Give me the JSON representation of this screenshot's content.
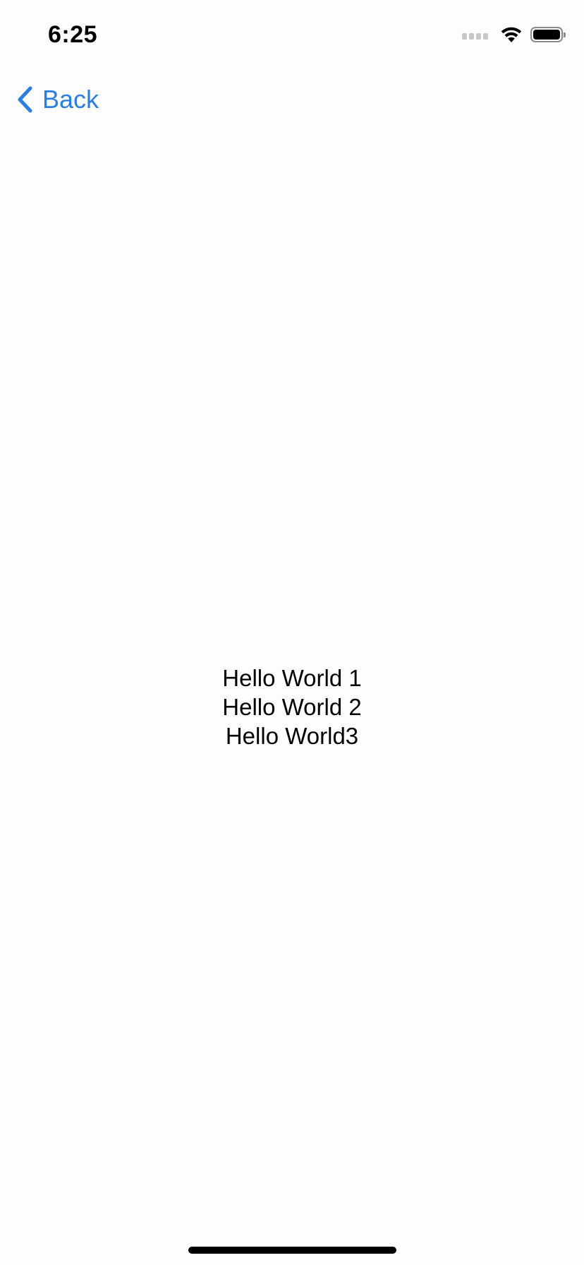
{
  "status_bar": {
    "time": "6:25",
    "icons": [
      "signal-icon",
      "wifi-icon",
      "battery-icon"
    ]
  },
  "nav": {
    "back_icon": "chevron-left-icon",
    "back_label": "Back",
    "accent_color": "#2b7fdc"
  },
  "content": {
    "lines": [
      "Hello World 1",
      "Hello World 2",
      "Hello World3"
    ]
  }
}
